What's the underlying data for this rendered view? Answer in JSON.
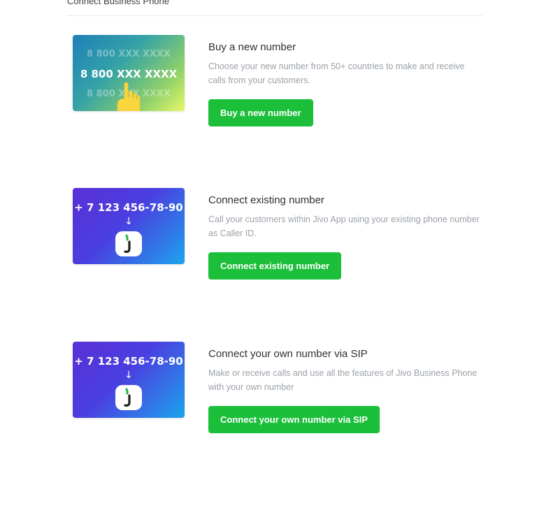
{
  "header": {
    "title": "Connect Business Phone"
  },
  "options": [
    {
      "title": "Buy a new number",
      "description": "Choose your new number from 50+ countries to make and receive calls from your customers.",
      "button": "Buy a new number",
      "card": {
        "lines": [
          "8 800 XXX XXXX",
          "8 800 XXX XXXX",
          "8 800 XXX XXXX"
        ],
        "icon": "pointing-hand-icon"
      }
    },
    {
      "title": "Connect existing number",
      "description": "Call your customers within Jivo App using your existing phone number as Caller ID.",
      "button": "Connect existing number",
      "card": {
        "number": "+ 7 123 456-78-90",
        "arrow": "↓",
        "icon": "jivo-app-icon"
      }
    },
    {
      "title": "Connect your own number via SIP",
      "description": "Make or receive calls and use all the features of Jivo Business Phone with your own number",
      "button": "Connect your own number via SIP",
      "card": {
        "number": "+ 7 123 456-78-90",
        "arrow": "↓",
        "icon": "jivo-app-icon"
      }
    }
  ],
  "colors": {
    "button": "#1bbf3a",
    "description": "#9ba1a8",
    "title": "#2f3033"
  }
}
